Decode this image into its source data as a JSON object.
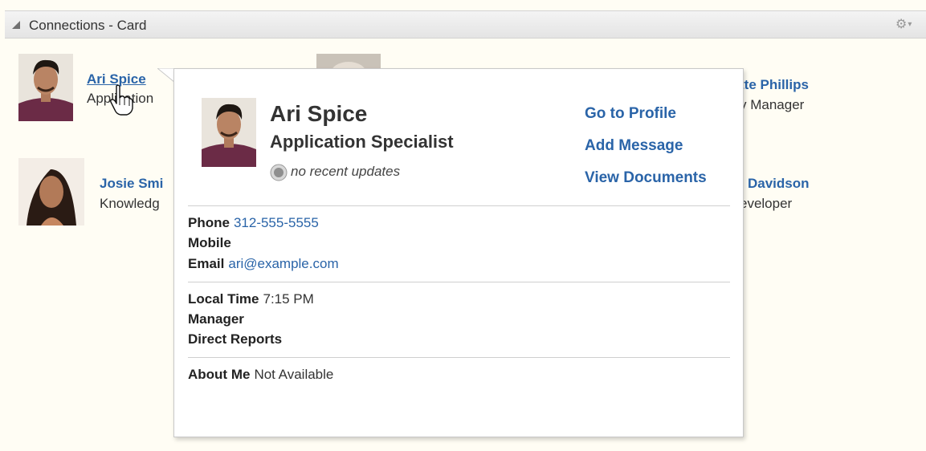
{
  "header": {
    "title": "Connections - Card",
    "collapse_icon": "triangle-collapse-icon",
    "settings_icon": "gear-icon"
  },
  "people": [
    {
      "name": "Ari Spice",
      "title": "Application Specialist",
      "visible_title": "Application"
    },
    {
      "name": "Josie Smi",
      "title": "Knowledg"
    },
    {
      "name": "tte Phillips",
      "title": "y Manager"
    },
    {
      "name": "Davidson",
      "title": "eveloper"
    }
  ],
  "card": {
    "name": "Ari Spice",
    "title": "Application Specialist",
    "status": "no recent updates",
    "links": {
      "profile": "Go to Profile",
      "message": "Add Message",
      "documents": "View Documents"
    },
    "contact": {
      "phone_label": "Phone",
      "phone": "312-555-5555",
      "mobile_label": "Mobile",
      "mobile": "",
      "email_label": "Email",
      "email": "ari@example.com"
    },
    "org": {
      "local_time_label": "Local Time",
      "local_time": "7:15 PM",
      "manager_label": "Manager",
      "manager": "",
      "reports_label": "Direct Reports",
      "reports": ""
    },
    "about": {
      "label": "About Me",
      "value": "Not Available"
    }
  },
  "colors": {
    "link": "#2a64a8",
    "background": "#fffdf4",
    "header": "#e8e8e8"
  }
}
